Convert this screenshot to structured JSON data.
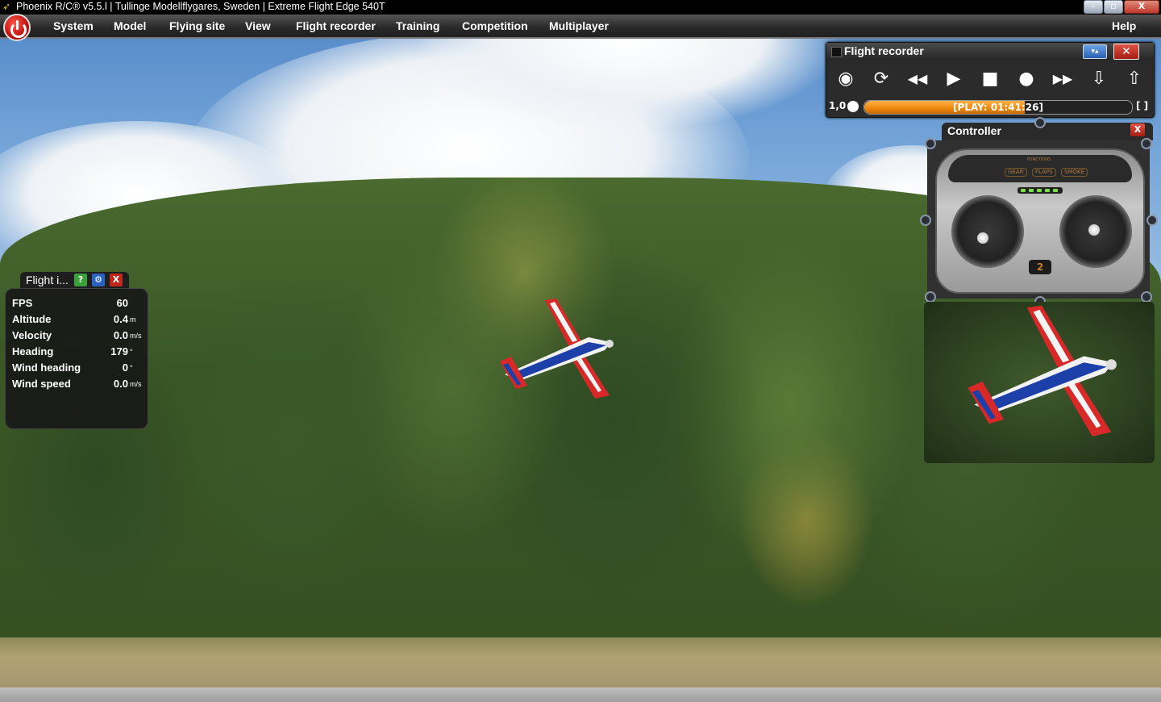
{
  "window": {
    "title": "Phoenix R/C® v5.5.l  |  Tullinge Modellflygares, Sweden  |  Extreme Flight Edge 540T",
    "minimize_glyph": "–",
    "maximize_glyph": "▫",
    "close_glyph": "X",
    "app_icon": "phoenix-bird-icon"
  },
  "menu": {
    "items": [
      "System",
      "Model",
      "Flying site",
      "View",
      "Flight recorder",
      "Training",
      "Competition",
      "Multiplayer"
    ],
    "help": "Help"
  },
  "flight_recorder": {
    "title": "Flight recorder",
    "collapse_glyph": "▾▴",
    "close_glyph": "✕",
    "buttons": [
      {
        "name": "camera-view-icon",
        "glyph": "◉"
      },
      {
        "name": "loop-icon",
        "glyph": "⟳"
      },
      {
        "name": "rewind-icon",
        "glyph": "◀◀"
      },
      {
        "name": "play-icon",
        "glyph": "▶"
      },
      {
        "name": "stop-icon",
        "glyph": "■"
      },
      {
        "name": "record-icon",
        "glyph": "●"
      },
      {
        "name": "fast-forward-icon",
        "glyph": "▶▶"
      },
      {
        "name": "import-icon",
        "glyph": "⇩"
      },
      {
        "name": "export-icon",
        "glyph": "⇧"
      }
    ],
    "speed": "1,0",
    "progress_label": "[PLAY: 01:41:26]",
    "progress_fraction": 0.6,
    "bracket_label": "[ ]",
    "accent": "#f08a10"
  },
  "flight_info": {
    "title": "Flight i...",
    "help_glyph": "?",
    "settings_glyph": "⚙",
    "close_glyph": "X",
    "rows": [
      {
        "label": "FPS",
        "value": "60",
        "unit": ""
      },
      {
        "label": "Altitude",
        "value": "0.4",
        "unit": "m"
      },
      {
        "label": "Velocity",
        "value": "0.0",
        "unit": "m/s"
      },
      {
        "label": "Heading",
        "value": "179",
        "unit": "°"
      },
      {
        "label": "Wind heading",
        "value": "0",
        "unit": "°"
      },
      {
        "label": "Wind speed",
        "value": "0.0",
        "unit": "m/s"
      }
    ]
  },
  "controller": {
    "title": "Controller",
    "close_glyph": "X",
    "functions_label": "FUNCTIONS",
    "switch_labels": [
      "GEAR",
      "FLAPS",
      "SMOKE"
    ],
    "mode_label": "2"
  }
}
